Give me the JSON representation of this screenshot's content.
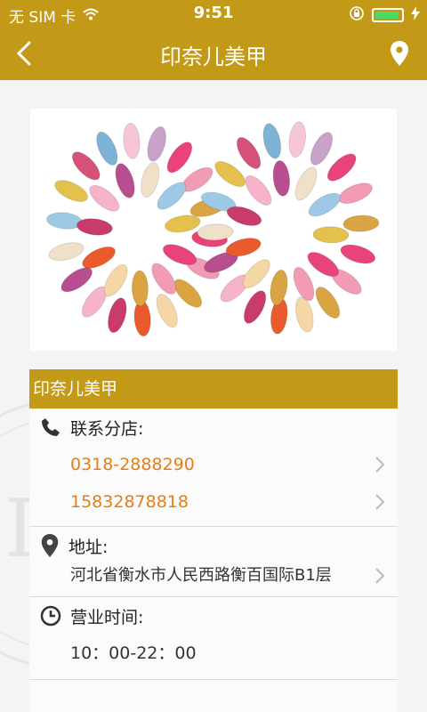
{
  "status_bar": {
    "carrier": "无 SIM 卡",
    "time": "9:51",
    "battery_level": 0.8
  },
  "nav": {
    "title": "印奈儿美甲",
    "back_icon": "back-chevron-icon",
    "location_icon": "location-pin-icon"
  },
  "colors": {
    "brand": "#c39a17",
    "phone": "#e67e14",
    "background": "#f4f4f4"
  },
  "card": {
    "title": "印奈儿美甲",
    "contact_label": "联系分店:",
    "phones": [
      "0318-2888290",
      "15832878818"
    ],
    "address_label": "地址:",
    "address": "河北省衡水市人民西路衡百国际B1层",
    "hours_label": "营业时间:",
    "hours": "10：00-22：00"
  }
}
